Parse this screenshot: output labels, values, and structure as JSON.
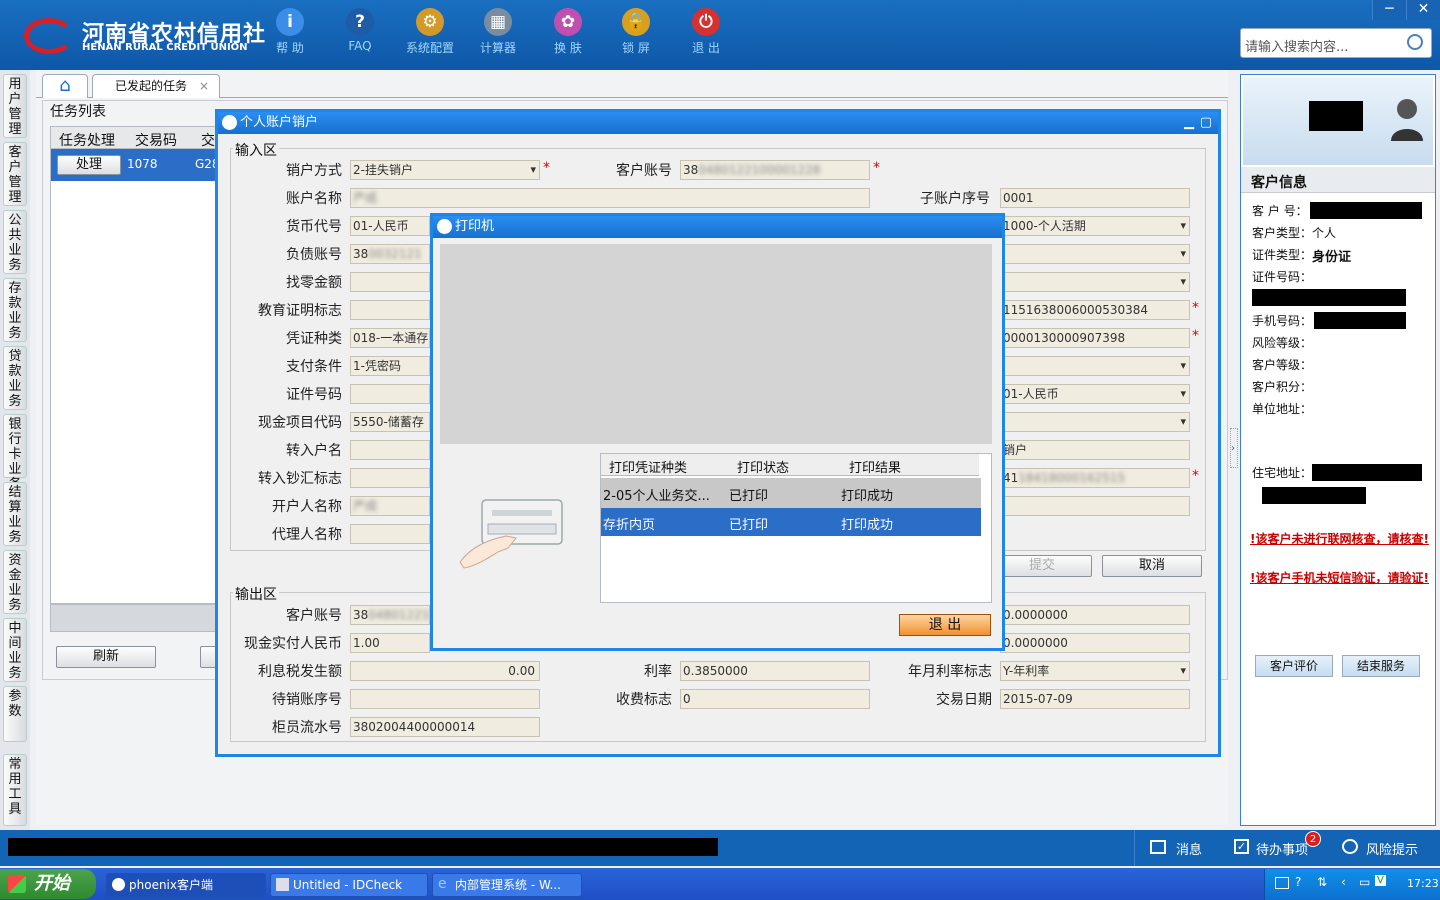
{
  "header": {
    "logo_cn": "河南省农村信用社",
    "logo_en": "HENAN RURAL CREDIT UNION",
    "toolbar": [
      {
        "label": "帮 助",
        "icon": "info-icon",
        "glyph": "i",
        "color": "#3a8ee8"
      },
      {
        "label": "FAQ",
        "icon": "question-icon",
        "glyph": "?",
        "color": "#1f5ca8"
      },
      {
        "label": "系统配置",
        "icon": "toolbox-icon",
        "glyph": "⚙",
        "color": "#d39a2a"
      },
      {
        "label": "计算器",
        "icon": "calculator-icon",
        "glyph": "▦",
        "color": "#7a8ca0"
      },
      {
        "label": "换 肤",
        "icon": "shirt-icon",
        "glyph": "✿",
        "color": "#c04fb0"
      },
      {
        "label": "锁 屏",
        "icon": "lock-icon",
        "glyph": "🔒",
        "color": "#d8a020"
      },
      {
        "label": "退 出",
        "icon": "power-icon",
        "glyph": "⏻",
        "color": "#d63030"
      }
    ],
    "search_placeholder": "请输入搜索内容...",
    "min_label": "─",
    "close_label": "✕"
  },
  "left_nav": [
    "用户管理",
    "客户管理",
    "公共业务",
    "存款业务",
    "贷款业务",
    "银行卡业务",
    "结算业务",
    "资金业务",
    "中间业务",
    "参数",
    "常用工具"
  ],
  "tabs": {
    "home_icon": "⌂",
    "active": "已发起的任务",
    "close": "×"
  },
  "task_list": {
    "title": "任务列表",
    "columns": [
      "任务处理",
      "交易码",
      "交"
    ],
    "row": {
      "action": "处理",
      "code": "1078",
      "extra": "G28"
    },
    "refresh": "刷新"
  },
  "main_dialog": {
    "title": "个人账户销户",
    "input_section": "输入区",
    "output_section": "输出区",
    "fields_left": [
      {
        "label": "销户方式",
        "value": "2-挂失销户",
        "dropdown": true,
        "required": true
      },
      {
        "label": "账户名称",
        "value": "严成",
        "blur": true
      },
      {
        "label": "货币代号",
        "value": "01-人民币"
      },
      {
        "label": "负债账号",
        "value": "38",
        "blur_tail": "0032121"
      },
      {
        "label": "找零金额",
        "value": ""
      },
      {
        "label": "教育证明标志",
        "value": ""
      },
      {
        "label": "凭证种类",
        "value": "018-一本通存"
      },
      {
        "label": "支付条件",
        "value": "1-凭密码"
      },
      {
        "label": "证件号码",
        "value": ""
      },
      {
        "label": "现金项目代码",
        "value": "5550-储蓄存"
      },
      {
        "label": "转入户名",
        "value": ""
      },
      {
        "label": "转入钞汇标志",
        "value": ""
      },
      {
        "label": "开户人名称",
        "value": "严成",
        "blur": true
      },
      {
        "label": "代理人名称",
        "value": ""
      }
    ],
    "customer_account": {
      "label": "客户账号",
      "value": "38",
      "blur_tail": "0480122100001228"
    },
    "sub_account": {
      "label": "子账户序号",
      "value": "0001"
    },
    "right_values": [
      {
        "value": "1000-个人活期",
        "dropdown": true
      },
      {
        "value": "",
        "dropdown": true
      },
      {
        "value": "",
        "dropdown": true
      },
      {
        "value": "1151638006000530384",
        "required": true
      },
      {
        "value": "0000130000907398",
        "required": true
      },
      {
        "value": "",
        "dropdown": true
      },
      {
        "value": "01-人民币",
        "dropdown": true
      },
      {
        "value": "",
        "dropdown": true
      },
      {
        "value": "销户"
      },
      {
        "value": "41",
        "blur_tail": "18418000162515",
        "required": true
      },
      {
        "value": ""
      }
    ],
    "submit": "提交",
    "cancel": "取消",
    "out_rows": [
      {
        "label": "客户账号",
        "value": "38",
        "blur_tail": "0480122100",
        "rvalue": "0.0000000"
      },
      {
        "label": "现金实付人民币",
        "value": "1.00",
        "rvalue": "0.0000000"
      }
    ],
    "interest_tax": {
      "label": "利息税发生额",
      "value": "0.00"
    },
    "rate": {
      "label": "利率",
      "value": "0.3850000"
    },
    "rate_flag": {
      "label": "年月利率标志",
      "value": "Y-年利率"
    },
    "pending_seq": {
      "label": "待销账序号",
      "value": ""
    },
    "fee_flag": {
      "label": "收费标志",
      "value": "0"
    },
    "tx_date": {
      "label": "交易日期",
      "value": "2015-07-09"
    },
    "teller_seq": {
      "label": "柜员流水号",
      "value": "3802004400000014"
    }
  },
  "printer_dialog": {
    "title": "打印机",
    "columns": [
      "打印凭证种类",
      "打印状态",
      "打印结果"
    ],
    "rows": [
      [
        "2-05个人业务交...",
        "已打印",
        "打印成功"
      ],
      [
        "存折内页",
        "已打印",
        "打印成功"
      ]
    ],
    "exit": "退 出"
  },
  "customer_panel": {
    "title": "客户信息",
    "items": [
      {
        "label": "客 户 号：",
        "value": ""
      },
      {
        "label": "客户类型：",
        "value": "个人"
      },
      {
        "label": "证件类型：",
        "value": "身份证"
      },
      {
        "label": "证件号码：",
        "value": ""
      },
      {
        "label": "手机号码：",
        "value": ""
      },
      {
        "label": "风险等级：",
        "value": ""
      },
      {
        "label": "客户等级：",
        "value": ""
      },
      {
        "label": "客户积分：",
        "value": ""
      },
      {
        "label": "单位地址：",
        "value": ""
      },
      {
        "label": "住宅地址：",
        "value": ""
      }
    ],
    "warn1": "!该客户未进行联网核查，请核查!",
    "warn2": "!该客户手机未短信验证，请验证!",
    "rate_btn": "客户评价",
    "end_btn": "结束服务"
  },
  "status_bar": {
    "message": "消息",
    "todo": "待办事项",
    "todo_count": "2",
    "risk": "风险提示"
  },
  "taskbar": {
    "start": "开始",
    "tasks": [
      "phoenix客户端",
      "Untitled - IDCheck",
      "内部管理系统 - W..."
    ],
    "clock": "17:23"
  }
}
